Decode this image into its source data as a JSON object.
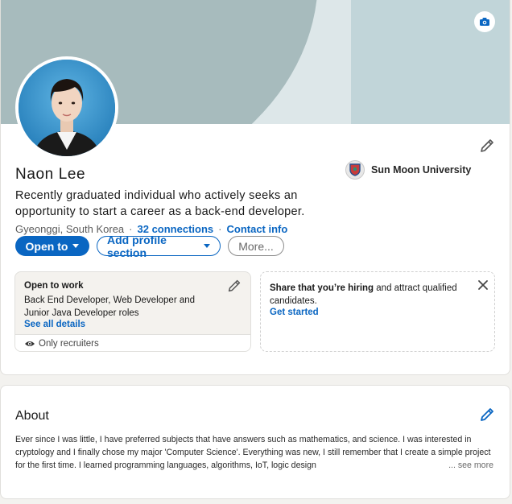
{
  "profile": {
    "name": "Naon Lee",
    "headline": "Recently graduated individual who actively seeks an opportunity to start a career as a back-end developer.",
    "location": "Gyeonggi, South Korea",
    "connections": "32 connections",
    "contact_info": "Contact info",
    "school": "Sun Moon University",
    "buttons": {
      "open_to": "Open to",
      "add_section": "Add profile section",
      "more": "More..."
    }
  },
  "open_to_work": {
    "title": "Open to work",
    "description": "Back End Developer, Web Developer and Junior Java Developer roles",
    "link": "See all details",
    "visibility": "Only recruiters"
  },
  "hiring": {
    "bold": "Share that you’re hiring",
    "rest": " and attract qualified candidates.",
    "link": "Get started"
  },
  "about": {
    "title": "About",
    "text": "Ever since I was little, I have preferred subjects that have answers such as mathematics, and science. I was interested in cryptology and I finally chose my major 'Computer Science'. Everything was new, I still remember that I create a simple project for the first time. I learned programming languages, algorithms, IoT, logic design",
    "see_more": "... see more"
  },
  "colors": {
    "brand_blue": "#0a66c2",
    "banner": "#c0d4d8",
    "page_bg": "#f3f2ef"
  }
}
